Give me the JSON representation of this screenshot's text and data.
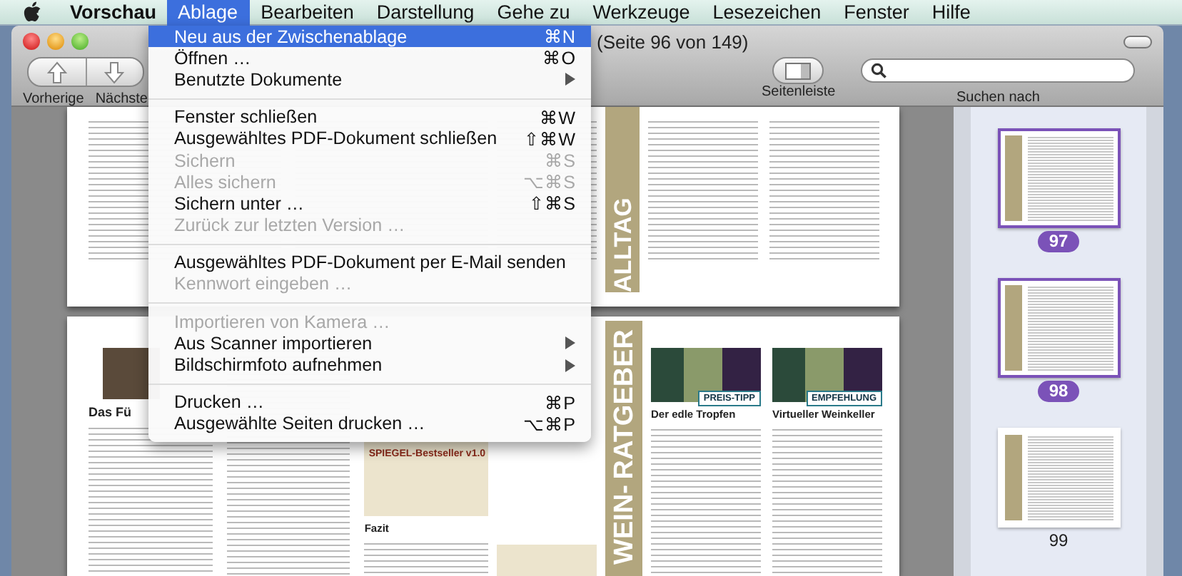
{
  "menu_bar": {
    "app_name": "Vorschau",
    "menus": [
      {
        "label": "Ablage",
        "selected": true
      },
      {
        "label": "Bearbeiten",
        "selected": false
      },
      {
        "label": "Darstellung",
        "selected": false
      },
      {
        "label": "Gehe zu",
        "selected": false
      },
      {
        "label": "Werkzeuge",
        "selected": false
      },
      {
        "label": "Lesezeichen",
        "selected": false
      },
      {
        "label": "Fenster",
        "selected": false
      },
      {
        "label": "Hilfe",
        "selected": false
      }
    ]
  },
  "open_menu": {
    "items": [
      {
        "kind": "item",
        "label": "Neu aus der Zwischenablage",
        "shortcut": "⌘N",
        "disabled": false,
        "selected": true
      },
      {
        "kind": "item",
        "label": "Öffnen …",
        "shortcut": "⌘O",
        "disabled": false,
        "selected": false
      },
      {
        "kind": "submenu",
        "label": "Benutzte Dokumente",
        "disabled": false,
        "selected": false
      },
      {
        "kind": "separator"
      },
      {
        "kind": "item",
        "label": "Fenster schließen",
        "shortcut": "⌘W",
        "disabled": false,
        "selected": false
      },
      {
        "kind": "item",
        "label": "Ausgewähltes PDF-Dokument schließen",
        "shortcut": "⇧⌘W",
        "disabled": false,
        "selected": false
      },
      {
        "kind": "item",
        "label": "Sichern",
        "shortcut": "⌘S",
        "disabled": true,
        "selected": false
      },
      {
        "kind": "item",
        "label": "Alles sichern",
        "shortcut": "⌥⌘S",
        "disabled": true,
        "selected": false
      },
      {
        "kind": "item",
        "label": "Sichern unter …",
        "shortcut": "⇧⌘S",
        "disabled": false,
        "selected": false
      },
      {
        "kind": "item",
        "label": "Zurück zur letzten Version …",
        "disabled": true,
        "selected": false
      },
      {
        "kind": "separator"
      },
      {
        "kind": "item",
        "label": "Ausgewähltes PDF-Dokument per E-Mail senden",
        "disabled": false,
        "selected": false
      },
      {
        "kind": "item",
        "label": "Kennwort eingeben …",
        "disabled": true,
        "selected": false
      },
      {
        "kind": "separator"
      },
      {
        "kind": "item",
        "label": "Importieren von Kamera …",
        "disabled": true,
        "selected": false
      },
      {
        "kind": "submenu",
        "label": "Aus Scanner importieren",
        "disabled": false,
        "selected": false
      },
      {
        "kind": "submenu",
        "label": "Bildschirmfoto aufnehmen",
        "disabled": false,
        "selected": false
      },
      {
        "kind": "separator"
      },
      {
        "kind": "item",
        "label": "Drucken …",
        "shortcut": "⌘P",
        "disabled": false,
        "selected": false
      },
      {
        "kind": "item",
        "label": "Ausgewählte Seiten drucken …",
        "shortcut": "⌥⌘P",
        "disabled": false,
        "selected": false
      }
    ]
  },
  "window": {
    "title": "(Seite 96 von 149)"
  },
  "toolbar": {
    "previous": "Vorherige",
    "next": "Nächste",
    "sidebar": "Seitenleiste",
    "search_label": "Suchen nach"
  },
  "document": {
    "top_page": {
      "banner": "ALLTAG"
    },
    "bottom_page": {
      "heading_left": "Das Fü",
      "banner_line_1": "WEIN-",
      "banner_line_2": "RATGEBER",
      "bestseller_box": "SPIEGEL-Bestseller v1.0",
      "fazit": "Fazit",
      "apps": [
        {
          "badge": "PREIS-TIPP",
          "title": "Der edle Tropfen"
        },
        {
          "badge": "EMPFEHLUNG",
          "title": "Virtueller Weinkeller"
        }
      ]
    }
  },
  "sidebar": {
    "thumbnails": [
      {
        "page": "97",
        "selected": true
      },
      {
        "page": "98",
        "selected": true
      },
      {
        "page": "99",
        "selected": false
      }
    ]
  }
}
